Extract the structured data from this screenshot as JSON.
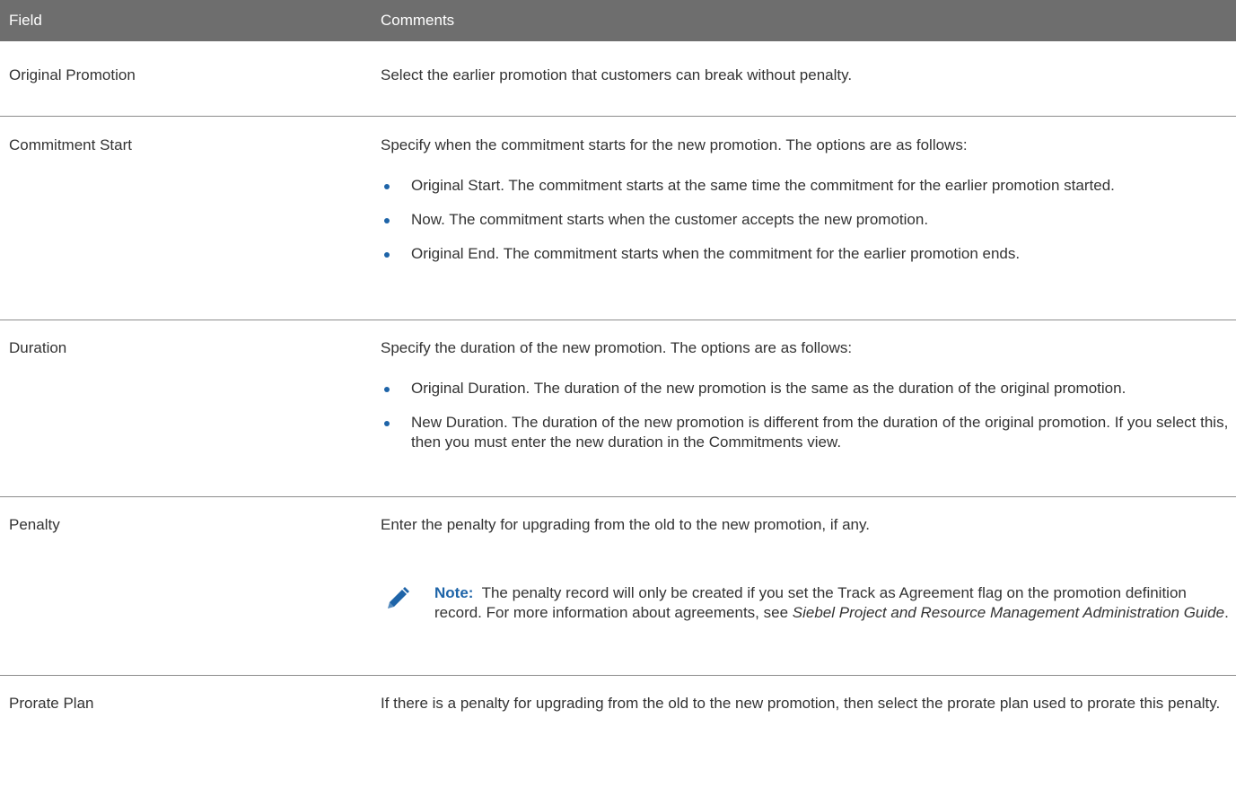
{
  "header": {
    "field_label": "Field",
    "comments_label": "Comments"
  },
  "rows": [
    {
      "field": "Original Promotion",
      "text": "Select the earlier promotion that customers can break without penalty."
    },
    {
      "field": "Commitment Start",
      "text": "Specify when the commitment starts for the new promotion. The options are as follows:",
      "options": [
        "Original Start. The commitment starts at the same time the commitment for the earlier promotion started.",
        "Now. The commitment starts when the customer accepts the new promotion.",
        "Original End. The commitment starts when the commitment for the earlier promotion ends."
      ]
    },
    {
      "field": "Duration",
      "text": "Specify the duration of the new promotion. The options are as follows:",
      "options": [
        "Original Duration. The duration of the new promotion is the same as the duration of the original promotion.",
        "New Duration. The duration of the new promotion is different from the duration of the original promotion. If you select this, then you must enter the new duration in the Commitments view."
      ]
    },
    {
      "field": "Penalty",
      "text": "Enter the penalty for upgrading from the old to the new promotion, if any.",
      "note": {
        "label": "Note:",
        "text": "The penalty record will only be created if you set the Track as Agreement flag on the promotion definition record. For more information about agreements, see",
        "link": "Siebel Project and Resource Management Administration Guide",
        "end": "."
      }
    },
    {
      "field": "Prorate Plan",
      "text": "If there is a penalty for upgrading from the old to the new promotion, then select the prorate plan used to prorate this penalty."
    }
  ],
  "icons": {
    "note": "pencil-icon"
  },
  "colors": {
    "header_bg": "#6e6e6e",
    "accent": "#1e64a8",
    "text": "#333333"
  }
}
